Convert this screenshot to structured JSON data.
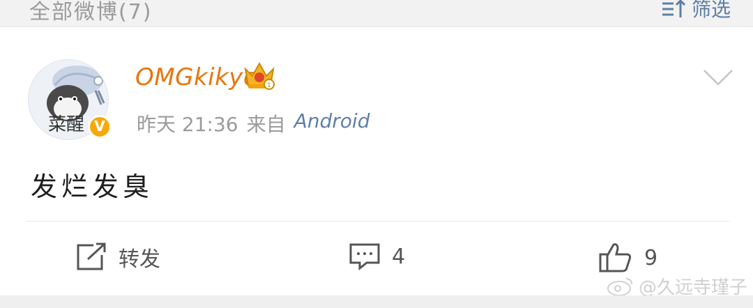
{
  "header": {
    "title": "全部微博(7)",
    "filter_label": "筛选",
    "filter_icon": "filter-icon"
  },
  "post": {
    "username": "OMGkikyo",
    "crown_icon": "crown-icon",
    "verified_badge": "V",
    "avatar_text": "菜醒",
    "time": "昨天 21:36",
    "source_prefix": "来自",
    "source": "Android",
    "content": "发烂发臭"
  },
  "actions": {
    "repost_label": "转发",
    "comment_count": "4",
    "like_count": "9"
  },
  "watermark": "@久远寺瑾子",
  "colors": {
    "username": "#e8760f",
    "source": "#5f7fa8",
    "verified": "#f7a90a",
    "meta": "#9b9b9b"
  }
}
